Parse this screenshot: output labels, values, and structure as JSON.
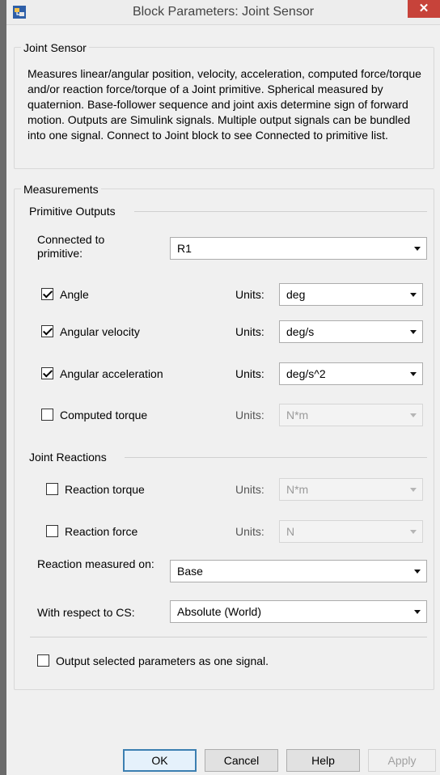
{
  "window": {
    "title": "Block Parameters: Joint Sensor",
    "close_glyph": "✕"
  },
  "header": {
    "legend": "Joint Sensor",
    "description": "Measures linear/angular position, velocity, acceleration, computed force/torque and/or reaction force/torque of a Joint primitive. Spherical measured by quaternion. Base-follower sequence and joint axis determine sign of forward motion. Outputs are Simulink signals. Multiple output signals can be bundled into one signal. Connect to Joint block to see Connected to primitive list."
  },
  "measurements": {
    "legend": "Measurements",
    "primitive_outputs": {
      "legend": "Primitive Outputs",
      "connected_label": "Connected to primitive:",
      "connected_value": "R1",
      "rows": [
        {
          "label": "Angle",
          "checked": true,
          "units_label": "Units:",
          "units": "deg",
          "enabled": true
        },
        {
          "label": "Angular velocity",
          "checked": true,
          "units_label": "Units:",
          "units": "deg/s",
          "enabled": true
        },
        {
          "label": "Angular acceleration",
          "checked": true,
          "units_label": "Units:",
          "units": "deg/s^2",
          "enabled": true
        },
        {
          "label": "Computed torque",
          "checked": false,
          "units_label": "Units:",
          "units": "N*m",
          "enabled": false
        }
      ]
    },
    "joint_reactions": {
      "legend": "Joint Reactions",
      "rows": [
        {
          "label": "Reaction torque",
          "checked": false,
          "units_label": "Units:",
          "units": "N*m",
          "enabled": false
        },
        {
          "label": "Reaction force",
          "checked": false,
          "units_label": "Units:",
          "units": "N",
          "enabled": false
        }
      ],
      "measured_on_label": "Reaction measured on:",
      "measured_on_value": "Base",
      "respect_label": "With respect to CS:",
      "respect_value": "Absolute (World)"
    },
    "one_signal_label": "Output selected parameters as one signal.",
    "one_signal_checked": false
  },
  "buttons": {
    "ok": "OK",
    "cancel": "Cancel",
    "help": "Help",
    "apply": "Apply"
  },
  "icons": {
    "app": "simulink-block-icon",
    "close": "close-icon",
    "dropdown": "chevron-down-icon"
  }
}
